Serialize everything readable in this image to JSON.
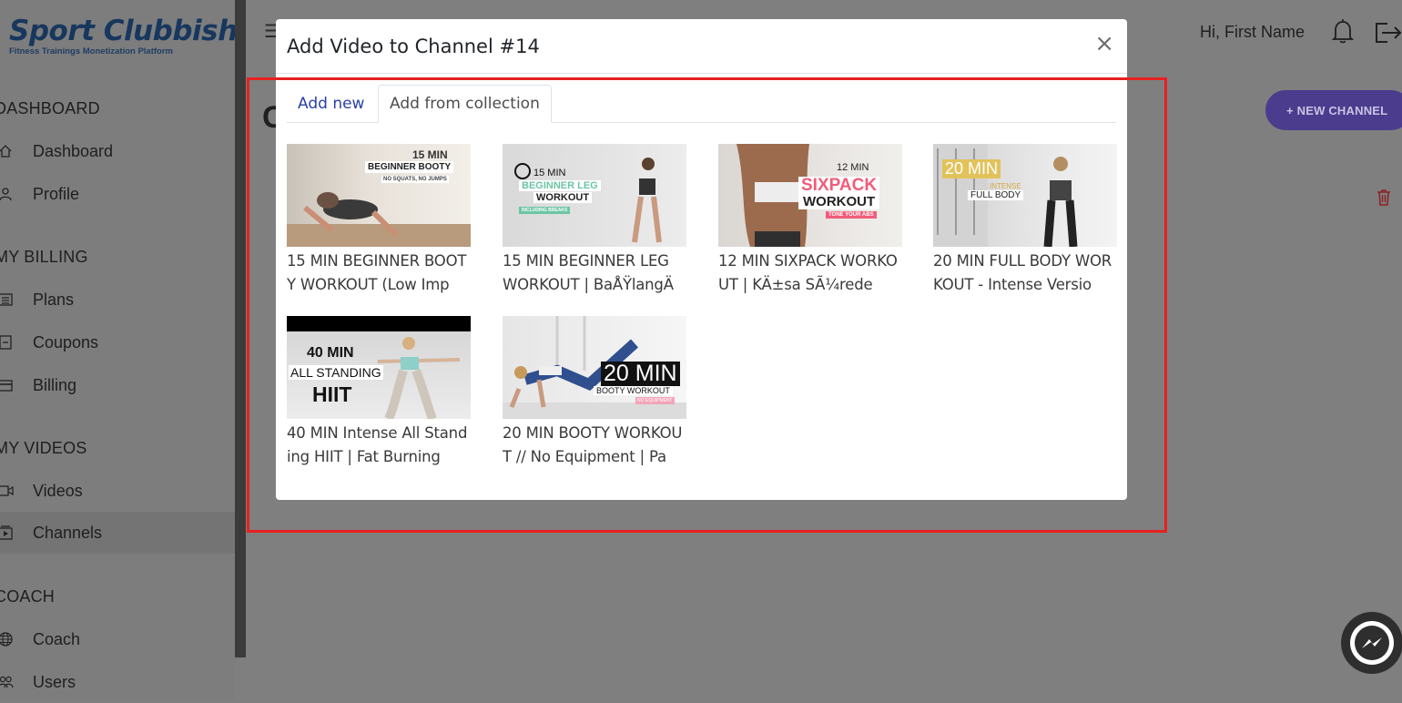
{
  "app": {
    "logo_title": "Sport Clubbish",
    "logo_subtitle": "Fitness Trainings Monetization Platform"
  },
  "sidebar": {
    "sections": [
      {
        "title": "DASHBOARD",
        "items": [
          {
            "label": "Dashboard",
            "icon": "home-icon"
          },
          {
            "label": "Profile",
            "icon": "user-icon"
          }
        ]
      },
      {
        "title": "MY BILLING",
        "items": [
          {
            "label": "Plans",
            "icon": "list-icon"
          },
          {
            "label": "Coupons",
            "icon": "coupon-icon"
          },
          {
            "label": "Billing",
            "icon": "card-icon"
          }
        ]
      },
      {
        "title": "MY VIDEOS",
        "items": [
          {
            "label": "Videos",
            "icon": "camera-icon"
          },
          {
            "label": "Channels",
            "icon": "channel-icon"
          }
        ]
      },
      {
        "title": "COACH",
        "items": [
          {
            "label": "Coach",
            "icon": "globe-icon"
          },
          {
            "label": "Users",
            "icon": "users-icon"
          }
        ]
      }
    ],
    "active_item": "Channels"
  },
  "header": {
    "greeting": "Hi, First Name"
  },
  "page": {
    "title_initial": "C",
    "new_channel_button": "+ NEW CHANNEL"
  },
  "modal": {
    "title": "Add Video to Channel #14",
    "close_symbol": "×",
    "tabs": [
      {
        "label": "Add new",
        "active": false
      },
      {
        "label": "Add from collection",
        "active": true
      }
    ],
    "videos": [
      {
        "title": "15 MIN BEGINNER BOOTY WORKOUT (Low Imp",
        "thumb_lines": [
          "15 MIN",
          "BEGINNER BOOTY",
          "NO SQUATS, NO JUMPS"
        ]
      },
      {
        "title": "15 MIN BEGINNER LEG WORKOUT | BaÅŸlangÄ",
        "thumb_lines": [
          "15 MIN",
          "BEGINNER LEG",
          "WORKOUT",
          "INCLUDING BREAKS"
        ]
      },
      {
        "title": "12 MIN SIXPACK WORKOUT | KÄ±sa SÃ¼rede",
        "thumb_lines": [
          "12 MIN",
          "SIXPACK",
          "WORKOUT",
          "TONE YOUR ABS"
        ]
      },
      {
        "title": "20 MIN FULL BODY WORKOUT - Intense Versio",
        "thumb_lines": [
          "20 MIN",
          "INTENSE",
          "FULL BODY"
        ]
      },
      {
        "title": "40 MIN Intense All Standing HIIT | Fat Burning",
        "thumb_lines": [
          "40 MIN",
          "ALL STANDING",
          "HIIT"
        ]
      },
      {
        "title": "20 MIN BOOTY WORKOUT // No Equipment | Pa",
        "thumb_lines": [
          "20 MIN",
          "BOOTY WORKOUT",
          "NO EQUIPMENT"
        ]
      }
    ]
  },
  "colors": {
    "overlay": "#7f7f7f",
    "accent_button": "#4b3c8e",
    "tab_link": "#2940a8",
    "highlight_border": "#e82020",
    "logo": "#17375e"
  }
}
